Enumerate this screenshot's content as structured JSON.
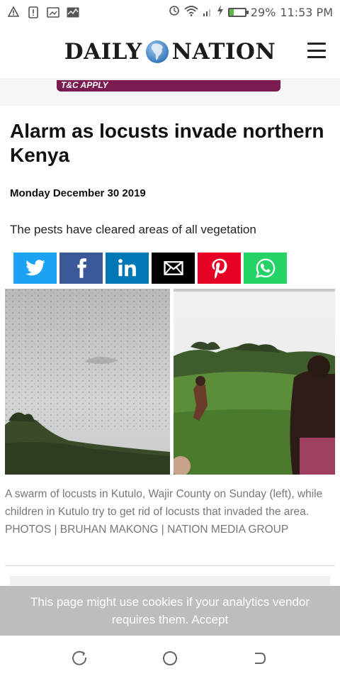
{
  "status_bar": {
    "battery": "29%",
    "time": "11:53 PM",
    "battery_level": 0.29,
    "left_icons": [
      "warning-icon",
      "sim-alert-icon",
      "screenshot-icon",
      "activity-icon"
    ],
    "right_icons": [
      "data-saver-icon",
      "wifi-icon",
      "signal-icon",
      "charging-icon",
      "battery-icon"
    ]
  },
  "header": {
    "brand_left": "DAILY",
    "brand_right": "NATION",
    "logo_icon": "africa-globe-icon",
    "menu_icon": "hamburger-menu-icon"
  },
  "ad": {
    "text": "T&C APPLY",
    "color": "#7a1b52"
  },
  "article": {
    "title": "Alarm as locusts invade northern Kenya",
    "date": "Monday December 30 2019",
    "summary": "The pests have cleared areas of all vegetation",
    "caption": "A swarm of locusts in Kutulo, Wajir County on Sunday (left), while children in Kutulo try to get rid of locusts that invaded the area. PHOTOS | BRUHAN MAKONG | NATION MEDIA GROUP"
  },
  "share_buttons": [
    {
      "name": "twitter",
      "icon": "twitter-icon",
      "color": "#1da1f2"
    },
    {
      "name": "facebook",
      "icon": "facebook-icon",
      "color": "#3b5998"
    },
    {
      "name": "linkedin",
      "icon": "linkedin-icon",
      "color": "#0077b5"
    },
    {
      "name": "email",
      "icon": "envelope-icon",
      "color": "#000000"
    },
    {
      "name": "pinterest",
      "icon": "pinterest-icon",
      "color": "#e60023"
    },
    {
      "name": "whatsapp",
      "icon": "whatsapp-icon",
      "color": "#25d366"
    }
  ],
  "cookie_banner": {
    "message": "This page might use cookies if your analytics vendor requires them.",
    "accept": "Accept"
  },
  "nav_bar": {
    "icons": [
      "back-icon",
      "home-icon",
      "recents-icon"
    ]
  }
}
